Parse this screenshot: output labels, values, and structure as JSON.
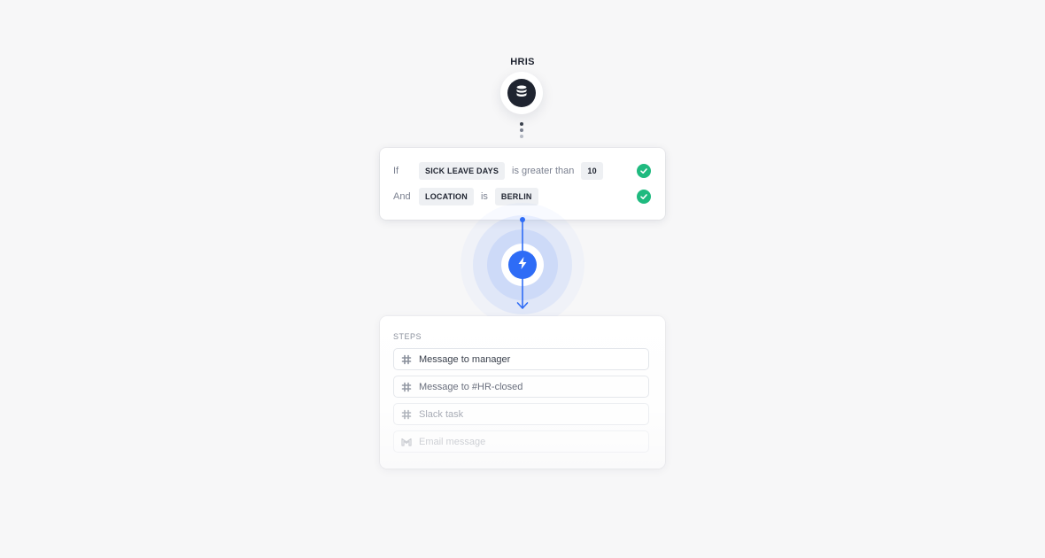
{
  "source": {
    "label": "HRIS",
    "icon": "database-icon"
  },
  "conditions": [
    {
      "keyword": "If",
      "field": "SICK LEAVE DAYS",
      "operator": "is greater than",
      "value": "10",
      "status": "check-icon"
    },
    {
      "keyword": "And",
      "field": "LOCATION",
      "operator": "is",
      "value": "BERLIN",
      "status": "check-icon"
    }
  ],
  "trigger": {
    "icon": "lightning-bolt-icon"
  },
  "steps": {
    "title": "STEPS",
    "items": [
      {
        "label": "Message to manager",
        "icon": "slack-icon"
      },
      {
        "label": "Message to #HR-closed",
        "icon": "slack-icon"
      },
      {
        "label": "Slack task",
        "icon": "slack-icon"
      },
      {
        "label": "Email message",
        "icon": "gmail-icon"
      }
    ]
  },
  "colors": {
    "accent": "#2e6cf6",
    "success": "#1fba7f",
    "node_dark": "#1f2430",
    "background": "#f7f7f8"
  }
}
